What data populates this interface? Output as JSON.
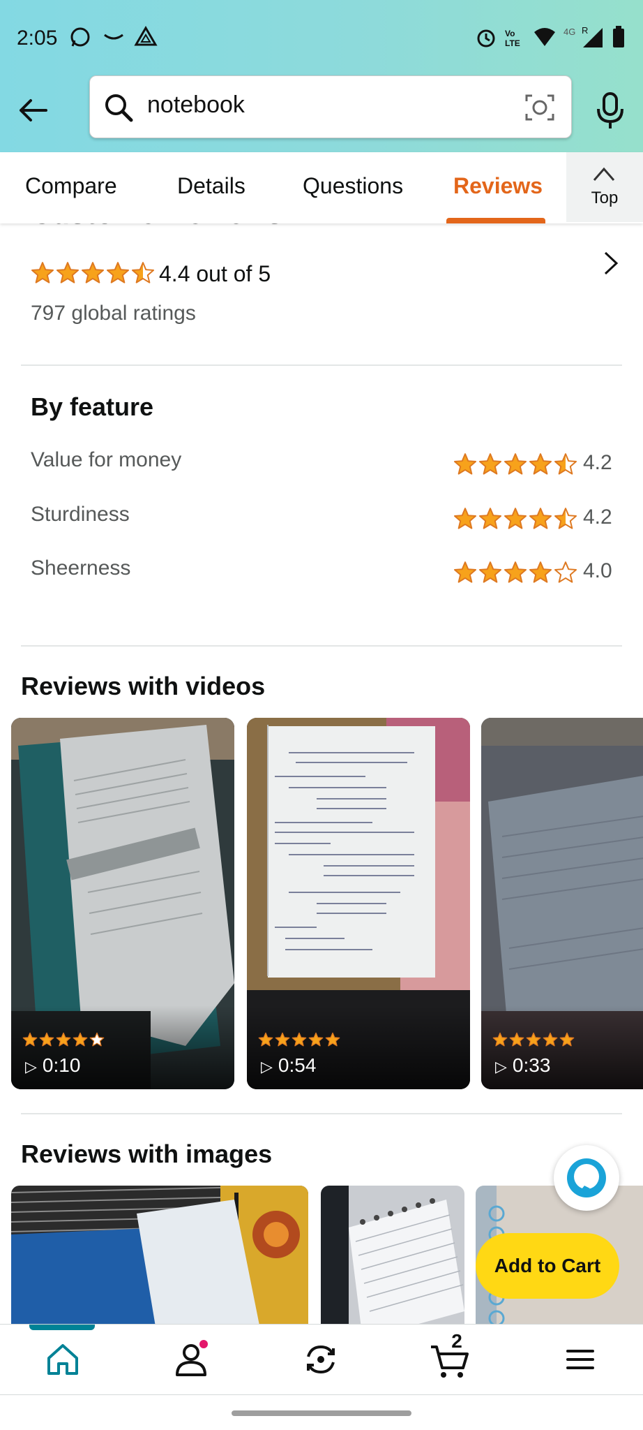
{
  "status_bar": {
    "time": "2:05",
    "icons": [
      "whatsapp-icon",
      "chat-icon",
      "drive-icon",
      "alarm-icon",
      "volte-icon",
      "wifi-icon",
      "signal-icon",
      "battery-icon"
    ]
  },
  "search": {
    "query": "notebook",
    "icons": [
      "back-arrow-icon",
      "search-icon",
      "camera-icon",
      "mic-icon"
    ]
  },
  "tabs": {
    "items": [
      "Compare",
      "Details",
      "Questions",
      "Reviews"
    ],
    "active": "Reviews",
    "top_label": "Top"
  },
  "customer_reviews": {
    "title": "Customer reviews",
    "average_text": "4.4 out of 5",
    "average_value": 4.4,
    "global_ratings": "797 global ratings"
  },
  "by_feature": {
    "title": "By feature",
    "features": [
      {
        "name": "Value for money",
        "rating_text": "4.2",
        "rating": 4.2
      },
      {
        "name": "Sturdiness",
        "rating_text": "4.2",
        "rating": 4.2
      },
      {
        "name": "Sheerness",
        "rating_text": "4.0",
        "rating": 4.0
      }
    ]
  },
  "videos": {
    "title": "Reviews with videos",
    "items": [
      {
        "duration": "0:10",
        "stars": 4
      },
      {
        "duration": "0:54",
        "stars": 5
      },
      {
        "duration": "0:33",
        "stars": 5
      }
    ]
  },
  "images": {
    "title": "Reviews with images"
  },
  "add_to_cart": "Add to Cart",
  "bottom_nav": {
    "cart_count": "2",
    "items": [
      "home-icon",
      "account-icon",
      "refresh-icon",
      "cart-icon",
      "menu-icon"
    ]
  },
  "colors": {
    "accent": "#e3661a",
    "star": "#f7a21b",
    "cart_button": "#ffd814",
    "nav_active": "#008296"
  }
}
